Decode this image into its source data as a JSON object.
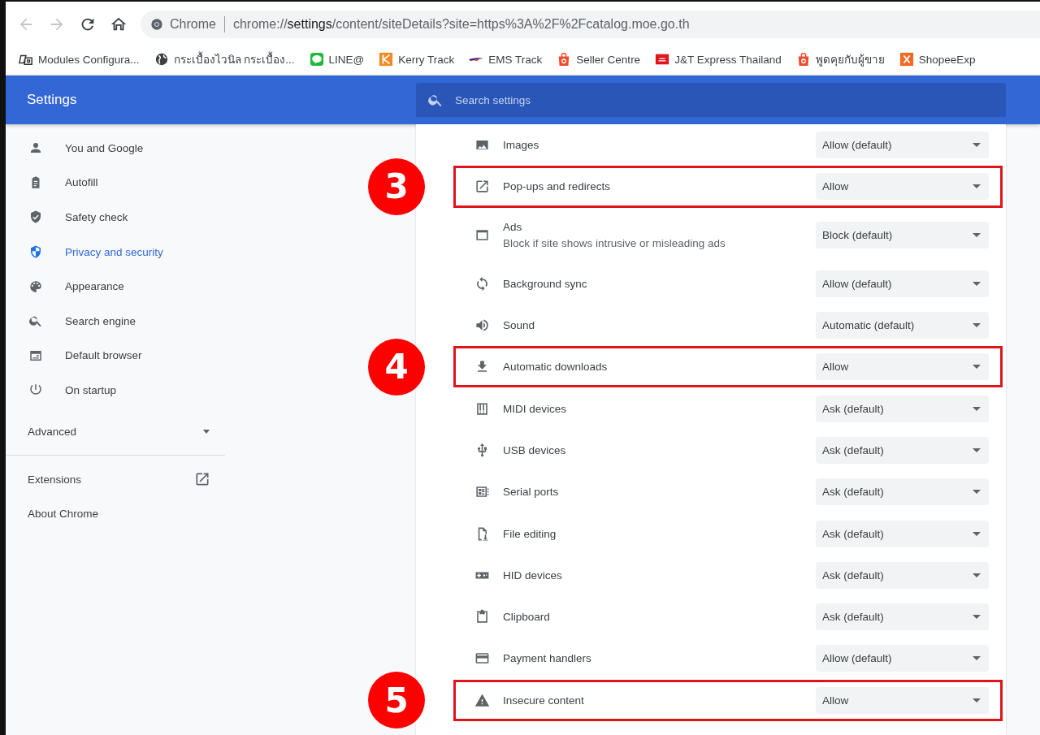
{
  "toolbar": {
    "back_disabled": true,
    "forward_disabled": true,
    "omnibox": {
      "origin": "Chrome",
      "url": "chrome://**settings**/content/siteDetails?site=https%3A%2F%2Fcatalog.moe.go.th"
    }
  },
  "bookmarks": [
    {
      "label": "Modules Configura...",
      "kind": "modules"
    },
    {
      "label": "กระเบื้องไวนิล กระเบื้อง...",
      "kind": "globe"
    },
    {
      "label": "LINE@",
      "kind": "line"
    },
    {
      "label": "Kerry Track",
      "kind": "kerry"
    },
    {
      "label": "EMS Track",
      "kind": "ems"
    },
    {
      "label": "Seller Centre",
      "kind": "bag"
    },
    {
      "label": "J&T Express Thailand",
      "kind": "jt"
    },
    {
      "label": "พูดคุยกับผู้ขาย",
      "kind": "bag"
    },
    {
      "label": "ShopeeExp",
      "kind": "x"
    }
  ],
  "header": {
    "title": "Settings",
    "search": {
      "placeholder": "Search settings"
    }
  },
  "sidebar": {
    "items": [
      {
        "label": "You and Google",
        "selected": false
      },
      {
        "label": "Autofill",
        "selected": false
      },
      {
        "label": "Safety check",
        "selected": false
      },
      {
        "label": "Privacy and security",
        "selected": true
      },
      {
        "label": "Appearance",
        "selected": false
      },
      {
        "label": "Search engine",
        "selected": false
      },
      {
        "label": "Default browser",
        "selected": false
      },
      {
        "label": "On startup",
        "selected": false
      }
    ],
    "advanced": {
      "label": "Advanced",
      "expanded": false
    },
    "links": [
      {
        "label": "Extensions"
      },
      {
        "label": "About Chrome"
      }
    ]
  },
  "permissions": [
    {
      "label": "Images",
      "value": "Allow (default)",
      "highlighted": false
    },
    {
      "label": "Pop-ups and redirects",
      "value": "Allow",
      "highlighted": true,
      "badge": "3"
    },
    {
      "label": "Ads",
      "description": "Block if site shows intrusive or misleading ads",
      "value": "Block (default)",
      "highlighted": false
    },
    {
      "label": "Background sync",
      "value": "Allow (default)",
      "highlighted": false
    },
    {
      "label": "Sound",
      "value": "Automatic (default)",
      "highlighted": false
    },
    {
      "label": "Automatic downloads",
      "value": "Allow",
      "highlighted": true,
      "badge": "4"
    },
    {
      "label": "MIDI devices",
      "value": "Ask (default)",
      "highlighted": false
    },
    {
      "label": "USB devices",
      "value": "Ask (default)",
      "highlighted": false
    },
    {
      "label": "Serial ports",
      "value": "Ask (default)",
      "highlighted": false
    },
    {
      "label": "File editing",
      "value": "Ask (default)",
      "highlighted": false
    },
    {
      "label": "HID devices",
      "value": "Ask (default)",
      "highlighted": false
    },
    {
      "label": "Clipboard",
      "value": "Ask (default)",
      "highlighted": false
    },
    {
      "label": "Payment handlers",
      "value": "Allow (default)",
      "highlighted": false
    },
    {
      "label": "Insecure content",
      "value": "Allow",
      "highlighted": true,
      "badge": "5"
    }
  ]
}
